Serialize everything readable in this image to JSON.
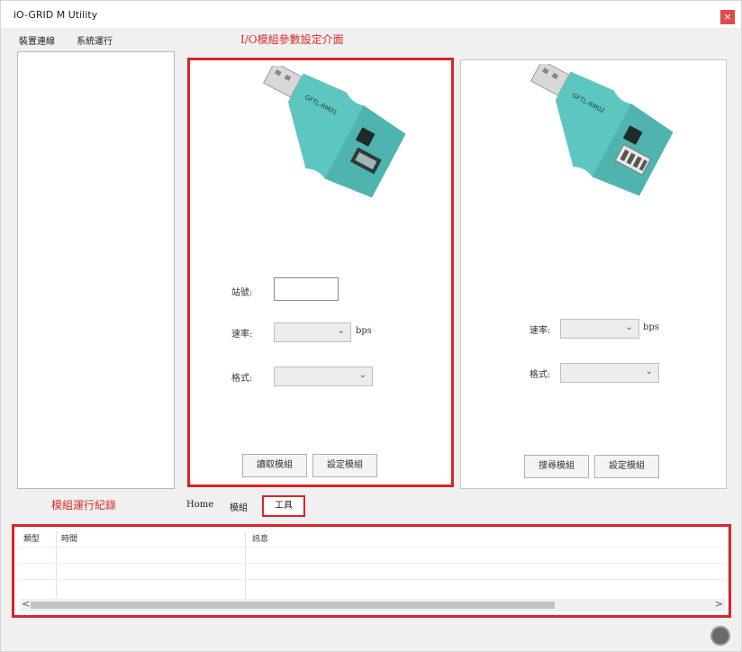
{
  "window": {
    "title": "iO-GRID M Utility",
    "close_glyph": "×"
  },
  "menu": {
    "items": [
      "裝置連線",
      "系統運行"
    ]
  },
  "annotations": {
    "page_title": "I/O模組參數設定介面",
    "left_panel": "模組運行紀錄"
  },
  "module_panel": {
    "device_label": "GFTL-RM01",
    "station_label": "站號:",
    "station_value": "",
    "baud_label": "速率:",
    "baud_unit": "bps",
    "format_label": "格式:",
    "read_button": "讀取模組",
    "set_button": "設定模組"
  },
  "search_panel": {
    "device_label": "GFTL-RM02",
    "baud_label": "速率:",
    "baud_unit": "bps",
    "format_label": "格式:",
    "search_button": "搜尋模組",
    "set_button": "設定模組"
  },
  "tabs": [
    "Home",
    "模組",
    "工具"
  ],
  "log": {
    "headers": [
      "類型",
      "時間",
      "訊息"
    ],
    "scroll_left": "<",
    "scroll_right": ">"
  },
  "colors": {
    "accent": "#d8242a",
    "device_body": "#5ec6c0",
    "device_dark": "#3f9f9a"
  },
  "icons": {
    "close": "close-icon",
    "chevron": "chevron-down-icon",
    "status": "status-icon"
  }
}
